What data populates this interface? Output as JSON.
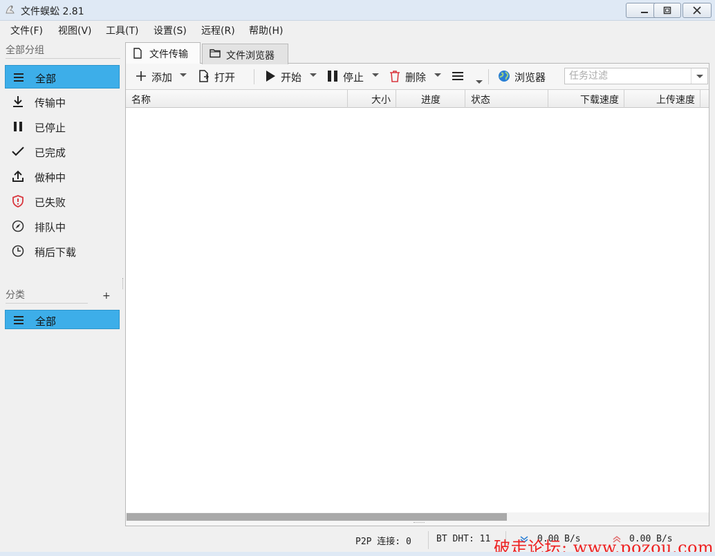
{
  "window": {
    "title": "文件蜈蚣 2.81"
  },
  "menu": [
    "文件(F)",
    "视图(V)",
    "工具(T)",
    "设置(S)",
    "远程(R)",
    "帮助(H)"
  ],
  "sidebar": {
    "group_heading": "全部分组",
    "groups": [
      {
        "label": "全部",
        "icon": "list-icon",
        "active": true
      },
      {
        "label": "传输中",
        "icon": "download-icon",
        "active": false
      },
      {
        "label": "已停止",
        "icon": "pause-icon",
        "active": false
      },
      {
        "label": "已完成",
        "icon": "check-icon",
        "active": false
      },
      {
        "label": "做种中",
        "icon": "upload-icon",
        "active": false
      },
      {
        "label": "已失败",
        "icon": "shield-alert-icon",
        "active": false
      },
      {
        "label": "排队中",
        "icon": "compass-icon",
        "active": false
      },
      {
        "label": "稍后下载",
        "icon": "clock-icon",
        "active": false
      }
    ],
    "category_heading": "分类",
    "add_label": "+",
    "categories": [
      {
        "label": "全部",
        "icon": "list-icon",
        "active": true
      }
    ]
  },
  "tabs": [
    {
      "label": "文件传输",
      "icon": "file-icon",
      "active": true
    },
    {
      "label": "文件浏览器",
      "icon": "folder-icon",
      "active": false
    }
  ],
  "toolbar": {
    "add": "添加",
    "open": "打开",
    "start": "开始",
    "stop": "停止",
    "delete": "删除",
    "browser": "浏览器",
    "filter_placeholder": "任务过滤"
  },
  "table": {
    "columns": [
      "名称",
      "大小",
      "进度",
      "状态",
      "下载速度",
      "上传速度"
    ],
    "rows": []
  },
  "status": {
    "p2p": "P2P 连接: 0",
    "dht": "BT DHT: 11",
    "down_speed": "0.00 B/s",
    "up_speed": "0.00 B/s"
  },
  "watermark": "破走论坛: www.pozou.com",
  "colors": {
    "accent": "#3daee9",
    "titlebar": "#dfe9f5",
    "delete_red": "#d9363e",
    "browser_blue": "#2a7fd4"
  }
}
